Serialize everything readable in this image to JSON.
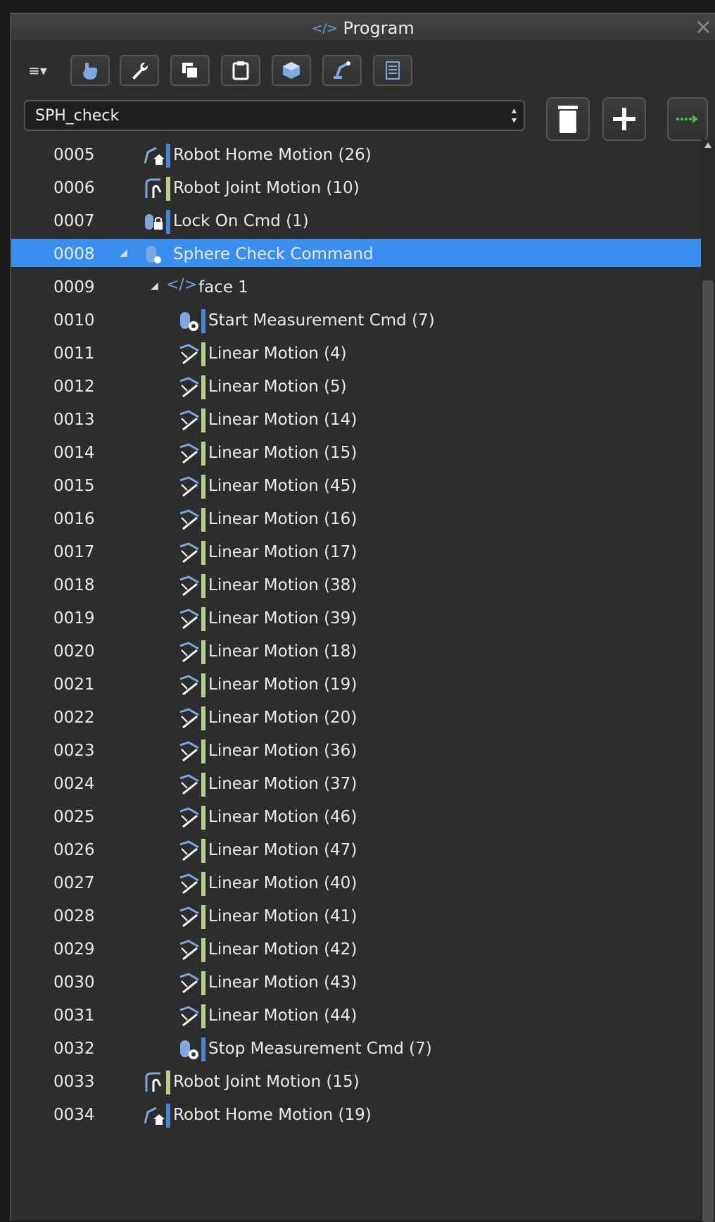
{
  "window": {
    "title": "Program",
    "close_glyph": "×"
  },
  "toolbar": {
    "menu_label": "≡▾",
    "buttons": [
      {
        "name": "hand-icon"
      },
      {
        "name": "wrench-icon"
      },
      {
        "name": "copy-icon"
      },
      {
        "name": "clipboard-icon"
      },
      {
        "name": "cube-icon"
      },
      {
        "name": "robot-arm-icon"
      },
      {
        "name": "list-icon"
      }
    ]
  },
  "program_select": {
    "value": "SPH_check",
    "arrows": "⌃⌄"
  },
  "action_buttons": [
    "trash-icon",
    "plus-icon",
    "run-arrow-icon"
  ],
  "colors": {
    "accent": "#3a8eef",
    "blue_bar": "#4a86d8",
    "green_bar": "#b6cf8d",
    "icon": "#7fa7e0"
  },
  "rows": [
    {
      "num": "0005",
      "label": "Robot Home Motion (26)",
      "icon": "home-motion-icon",
      "bar": "blue",
      "level": 0
    },
    {
      "num": "0006",
      "label": "Robot Joint Motion (10)",
      "icon": "joint-motion-icon",
      "bar": "green",
      "level": 0
    },
    {
      "num": "0007",
      "label": "Lock On Cmd (1)",
      "icon": "lock-cmd-icon",
      "bar": "blue",
      "level": 0
    },
    {
      "num": "0008",
      "label": "Sphere Check Command",
      "icon": "sphere-check-icon",
      "bar": "none",
      "level": 0,
      "expand": true,
      "selected": true
    },
    {
      "num": "0009",
      "label": "face 1",
      "icon": "code-icon",
      "bar": "none",
      "level": 1,
      "expand": true
    },
    {
      "num": "0010",
      "label": "Start Measurement Cmd (7)",
      "icon": "measure-cmd-icon",
      "bar": "blue",
      "level": 2
    },
    {
      "num": "0011",
      "label": "Linear Motion (4)",
      "icon": "linear-motion-icon",
      "bar": "green",
      "level": 2
    },
    {
      "num": "0012",
      "label": "Linear Motion (5)",
      "icon": "linear-motion-icon",
      "bar": "green",
      "level": 2
    },
    {
      "num": "0013",
      "label": "Linear Motion (14)",
      "icon": "linear-motion-icon",
      "bar": "green",
      "level": 2
    },
    {
      "num": "0014",
      "label": "Linear Motion (15)",
      "icon": "linear-motion-icon",
      "bar": "green",
      "level": 2
    },
    {
      "num": "0015",
      "label": "Linear Motion (45)",
      "icon": "linear-motion-icon",
      "bar": "green",
      "level": 2
    },
    {
      "num": "0016",
      "label": "Linear Motion (16)",
      "icon": "linear-motion-icon",
      "bar": "green",
      "level": 2
    },
    {
      "num": "0017",
      "label": "Linear Motion (17)",
      "icon": "linear-motion-icon",
      "bar": "green",
      "level": 2
    },
    {
      "num": "0018",
      "label": "Linear Motion (38)",
      "icon": "linear-motion-icon",
      "bar": "green",
      "level": 2
    },
    {
      "num": "0019",
      "label": "Linear Motion (39)",
      "icon": "linear-motion-icon",
      "bar": "green",
      "level": 2
    },
    {
      "num": "0020",
      "label": "Linear Motion (18)",
      "icon": "linear-motion-icon",
      "bar": "green",
      "level": 2
    },
    {
      "num": "0021",
      "label": "Linear Motion (19)",
      "icon": "linear-motion-icon",
      "bar": "green",
      "level": 2
    },
    {
      "num": "0022",
      "label": "Linear Motion (20)",
      "icon": "linear-motion-icon",
      "bar": "green",
      "level": 2
    },
    {
      "num": "0023",
      "label": "Linear Motion (36)",
      "icon": "linear-motion-icon",
      "bar": "green",
      "level": 2
    },
    {
      "num": "0024",
      "label": "Linear Motion (37)",
      "icon": "linear-motion-icon",
      "bar": "green",
      "level": 2
    },
    {
      "num": "0025",
      "label": "Linear Motion (46)",
      "icon": "linear-motion-icon",
      "bar": "green",
      "level": 2
    },
    {
      "num": "0026",
      "label": "Linear Motion (47)",
      "icon": "linear-motion-icon",
      "bar": "green",
      "level": 2
    },
    {
      "num": "0027",
      "label": "Linear Motion (40)",
      "icon": "linear-motion-icon",
      "bar": "green",
      "level": 2
    },
    {
      "num": "0028",
      "label": "Linear Motion (41)",
      "icon": "linear-motion-icon",
      "bar": "green",
      "level": 2
    },
    {
      "num": "0029",
      "label": "Linear Motion (42)",
      "icon": "linear-motion-icon",
      "bar": "green",
      "level": 2
    },
    {
      "num": "0030",
      "label": "Linear Motion (43)",
      "icon": "linear-motion-icon",
      "bar": "green",
      "level": 2
    },
    {
      "num": "0031",
      "label": "Linear Motion (44)",
      "icon": "linear-motion-icon",
      "bar": "green",
      "level": 2
    },
    {
      "num": "0032",
      "label": "Stop Measurement Cmd (7)",
      "icon": "measure-cmd-icon",
      "bar": "blue",
      "level": 2
    },
    {
      "num": "0033",
      "label": "Robot Joint Motion (15)",
      "icon": "joint-motion-icon",
      "bar": "green",
      "level": 0
    },
    {
      "num": "0034",
      "label": "Robot Home Motion (19)",
      "icon": "home-motion-icon",
      "bar": "blue",
      "level": 0
    }
  ]
}
